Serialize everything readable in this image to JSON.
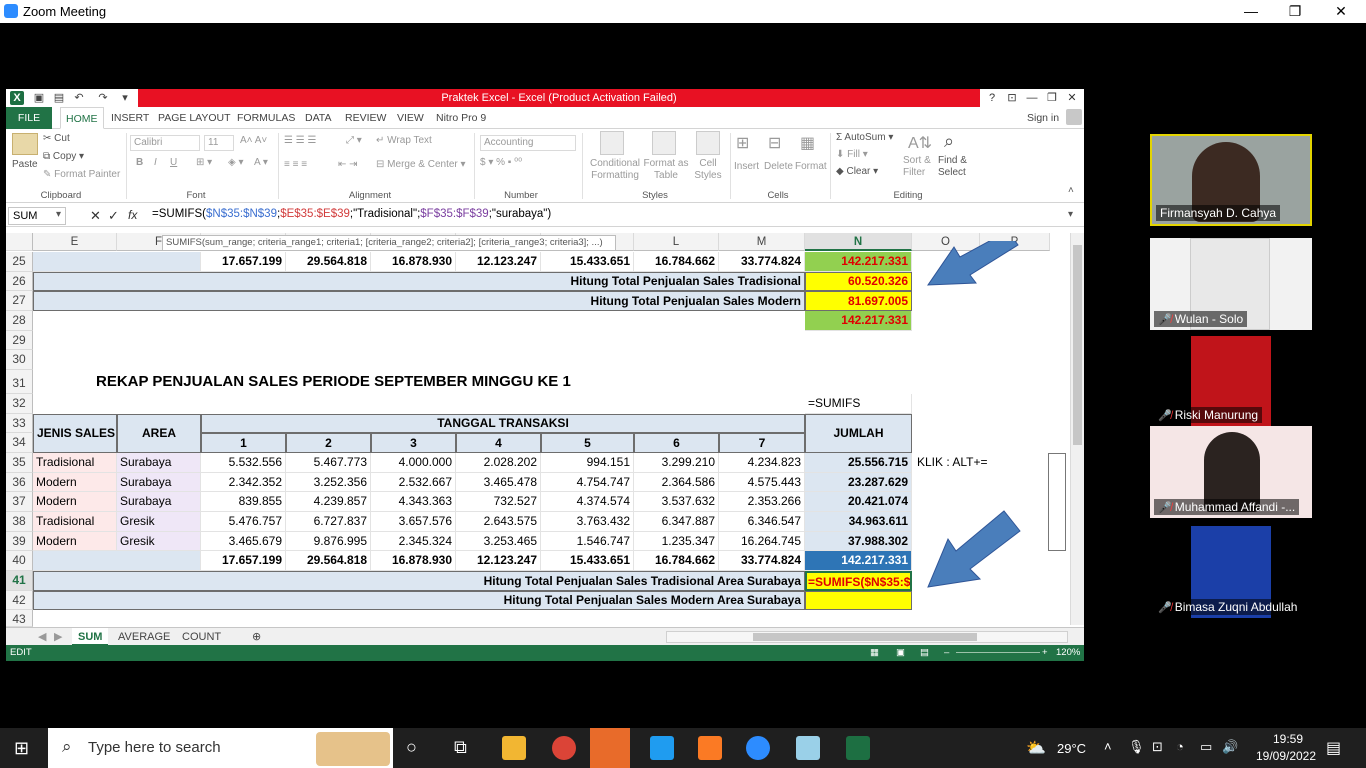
{
  "zoom": {
    "title": "Zoom Meeting",
    "win_min": "—",
    "win_max": "❐",
    "win_close": "✕"
  },
  "excel": {
    "title": "Praktek Excel -  Excel (Product Activation Failed)",
    "help": "?",
    "signin": "Sign in",
    "tabs": [
      "FILE",
      "HOME",
      "INSERT",
      "PAGE LAYOUT",
      "FORMULAS",
      "DATA",
      "REVIEW",
      "VIEW",
      "Nitro Pro 9"
    ],
    "ribbon": {
      "clipboard": {
        "paste": "Paste",
        "cut": "Cut",
        "copy": "Copy",
        "format_painter": "Format Painter",
        "label": "Clipboard"
      },
      "font": {
        "family": "Calibri",
        "size": "11",
        "label": "Font",
        "bold": "B",
        "italic": "I",
        "underline": "U"
      },
      "alignment": {
        "wrap_text": "Wrap Text",
        "merge_center": "Merge & Center",
        "label": "Alignment"
      },
      "number": {
        "format": "Accounting",
        "label": "Number"
      },
      "styles": {
        "conditional": "Conditional Formatting",
        "format_as": "Format as Table",
        "cell_styles": "Cell Styles",
        "label": "Styles"
      },
      "cells": {
        "insert": "Insert",
        "delete": "Delete",
        "format": "Format",
        "label": "Cells"
      },
      "editing": {
        "autosum": "AutoSum",
        "fill": "Fill",
        "clear": "Clear",
        "sort": "Sort & Filter",
        "find": "Find & Select",
        "label": "Editing"
      }
    },
    "name_box": "SUM",
    "formula_parts": [
      "=SUMIFS(",
      "$N$35:$N$39",
      ";",
      "$E$35:$E$39",
      ";\"Tradisional\";",
      "$F$35:$F$39",
      ";\"surabaya\")"
    ],
    "tooltip": "SUMIFS(sum_range; criteria_range1; criteria1; [criteria_range2; criteria2]; [criteria_range3; criteria3]; ...)",
    "columns": [
      "E",
      "F",
      "G",
      "H",
      "I",
      "J",
      "K",
      "L",
      "M",
      "N",
      "O",
      "P"
    ],
    "rows": {
      "r25": {
        "num": "25",
        "vals": [
          "17.657.199",
          "29.564.818",
          "16.878.930",
          "12.123.247",
          "15.433.651",
          "16.784.662",
          "33.774.824"
        ],
        "total": "142.217.331"
      },
      "r26": {
        "num": "26",
        "label": "Hitung Total Penjualan Sales Tradisional",
        "total": "60.520.326"
      },
      "r27": {
        "num": "27",
        "label": "Hitung Total Penjualan Sales Modern",
        "total": "81.697.005"
      },
      "r28": {
        "num": "28",
        "total": "142.217.331"
      },
      "r29": {
        "num": "29"
      },
      "r30": {
        "num": "30"
      },
      "r31": {
        "num": "31",
        "title": "REKAP PENJUALAN SALES PERIODE SEPTEMBER MINGGU KE 1"
      },
      "r32": {
        "num": "32",
        "note": "=SUMIFS"
      },
      "r33": {
        "num": "33"
      },
      "r34": {
        "num": "34"
      }
    },
    "table_header": {
      "jenis": "JENIS SALES",
      "area": "AREA",
      "tanggal": "TANGGAL TRANSAKSI",
      "jumlah": "JUMLAH",
      "days": [
        "1",
        "2",
        "3",
        "4",
        "5",
        "6",
        "7"
      ]
    },
    "data_rows": [
      {
        "num": "35",
        "jenis": "Tradisional",
        "area": "Surabaya",
        "vals": [
          "5.532.556",
          "5.467.773",
          "4.000.000",
          "2.028.202",
          "994.151",
          "3.299.210",
          "4.234.823"
        ],
        "total": "25.556.715"
      },
      {
        "num": "36",
        "jenis": "Modern",
        "area": "Surabaya",
        "vals": [
          "2.342.352",
          "3.252.356",
          "2.532.667",
          "3.465.478",
          "4.754.747",
          "2.364.586",
          "4.575.443"
        ],
        "total": "23.287.629"
      },
      {
        "num": "37",
        "jenis": "Modern",
        "area": "Surabaya",
        "vals": [
          "839.855",
          "4.239.857",
          "4.343.363",
          "732.527",
          "4.374.574",
          "3.537.632",
          "2.353.266"
        ],
        "total": "20.421.074"
      },
      {
        "num": "38",
        "jenis": "Tradisional",
        "area": "Gresik",
        "vals": [
          "5.476.757",
          "6.727.837",
          "3.657.576",
          "2.643.575",
          "3.763.432",
          "6.347.887",
          "6.346.547"
        ],
        "total": "34.963.611"
      },
      {
        "num": "39",
        "jenis": "Modern",
        "area": "Gresik",
        "vals": [
          "3.465.679",
          "9.876.995",
          "2.345.324",
          "3.253.465",
          "1.546.747",
          "1.235.347",
          "16.264.745"
        ],
        "total": "37.988.302"
      }
    ],
    "r40": {
      "num": "40",
      "vals": [
        "17.657.199",
        "29.564.818",
        "16.878.930",
        "12.123.247",
        "15.433.651",
        "16.784.662",
        "33.774.824"
      ],
      "total": "142.217.331"
    },
    "r41": {
      "num": "41",
      "label": "Hitung Total Penjualan Sales Tradisional Area Surabaya",
      "edit": "=SUMIFS($N$35:$"
    },
    "r42": {
      "num": "42",
      "label": "Hitung Total Penjualan Sales Modern Area Surabaya"
    },
    "r43": {
      "num": "43"
    },
    "klik_note": "KLIK : ALT+=",
    "sheets": [
      "SUM",
      "AVERAGE",
      "COUNT"
    ],
    "status": {
      "mode": "EDIT",
      "zoom": "120%"
    }
  },
  "participants": [
    {
      "name": "Firmansyah D. Cahya",
      "muted": false
    },
    {
      "name": "Wulan - Solo",
      "muted": true
    },
    {
      "name": "Riski Manurung",
      "muted": true
    },
    {
      "name": "Muhammad Affandi -...",
      "muted": true
    },
    {
      "name": "Bimasa Zuqni Abdullah",
      "muted": true
    }
  ],
  "taskbar": {
    "search_placeholder": "Type here to search",
    "temperature": "29°C",
    "time": "19:59",
    "date": "19/09/2022"
  },
  "colors": {
    "excel_green": "#217346",
    "accent_blue": "#2d8cff",
    "highlight_yellow": "#ffff00",
    "total_green": "#92d050",
    "title_red": "#e81123"
  }
}
